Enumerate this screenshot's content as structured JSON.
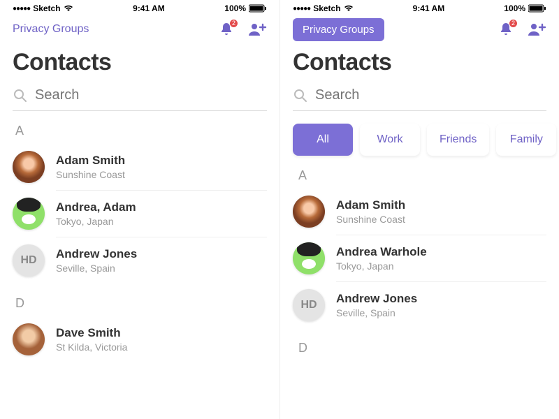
{
  "statusbar": {
    "carrier": "Sketch",
    "time": "9:41 AM",
    "battery": "100%"
  },
  "left": {
    "privacy_label": "Privacy Groups",
    "notif_badge": "2",
    "title": "Contacts",
    "search_placeholder": "Search",
    "sections": [
      {
        "letter": "A",
        "rows": [
          {
            "avatar": "av1",
            "name": "Adam Smith",
            "sub": "Sunshine Coast"
          },
          {
            "avatar": "av2",
            "name": "Andrea, Adam",
            "sub": "Tokyo, Japan"
          },
          {
            "avatar": "av3",
            "initials": "HD",
            "name": "Andrew Jones",
            "sub": "Seville, Spain"
          }
        ]
      },
      {
        "letter": "D",
        "rows": [
          {
            "avatar": "av4",
            "name": "Dave Smith",
            "sub": "St Kilda, Victoria"
          }
        ]
      }
    ]
  },
  "right": {
    "privacy_label": "Privacy Groups",
    "notif_badge": "2",
    "title": "Contacts",
    "search_placeholder": "Search",
    "tabs": [
      {
        "label": "All",
        "active": true
      },
      {
        "label": "Work",
        "active": false
      },
      {
        "label": "Friends",
        "active": false
      },
      {
        "label": "Family",
        "active": false
      }
    ],
    "sections": [
      {
        "letter": "A",
        "rows": [
          {
            "avatar": "av1",
            "name": "Adam Smith",
            "sub": "Sunshine Coast"
          },
          {
            "avatar": "av2",
            "name": "Andrea Warhole",
            "sub": "Tokyo, Japan"
          },
          {
            "avatar": "av3",
            "initials": "HD",
            "name": "Andrew Jones",
            "sub": "Seville, Spain"
          }
        ]
      },
      {
        "letter": "D",
        "rows": []
      }
    ]
  }
}
